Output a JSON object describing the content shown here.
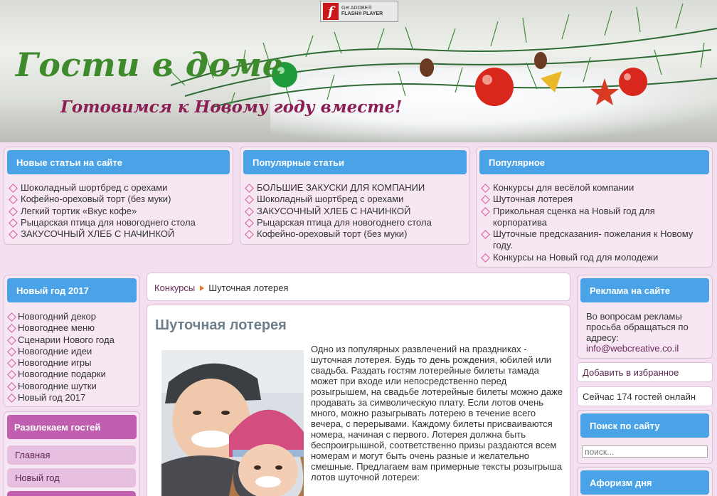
{
  "header": {
    "site_title": "Гости в доме",
    "slogan": "Готовимся к Новому году вместе!",
    "flash_badge": {
      "line1": "Get ADOBE®",
      "line2": "FLASH® PLAYER"
    }
  },
  "top_boxes": [
    {
      "title": "Новые статьи на сайте",
      "items": [
        "Шоколадный шортбред с орехами",
        "Кофейно-ореховый торт (без муки)",
        "Легкий тортик «Вкус кофе»",
        "Рыцарская птица для новогоднего стола",
        "ЗАКУСОЧНЫЙ ХЛЕБ С НАЧИНКОЙ"
      ]
    },
    {
      "title": "Популярные статьи",
      "items": [
        "БОЛЬШИЕ ЗАКУСКИ ДЛЯ КОМПАНИИ",
        "Шоколадный шортбред с орехами",
        "ЗАКУСОЧНЫЙ ХЛЕБ С НАЧИНКОЙ",
        "Рыцарская птица для новогоднего стола",
        "Кофейно-ореховый торт (без муки)"
      ]
    },
    {
      "title": "Популярное",
      "items": [
        "Конкурсы для весёлой компании",
        "Шуточная лотерея",
        "Прикольная сценка на Новый год для корпоратива",
        "Шуточные предсказания- пожелания к Новому году.",
        "Конкурсы на Новый год для молодежи"
      ]
    }
  ],
  "left_sidebar": {
    "newyear_box": {
      "title": "Новый год 2017",
      "items": [
        "Новогодний декор",
        "Новогоднее меню",
        "Сценарии Нового года",
        "Новогодние идеи",
        "Новогодние игры",
        "Новогодние подарки",
        "Новогодние шутки",
        "Новый год 2017"
      ]
    },
    "menu_box": {
      "title": "Развлекаем гостей",
      "items": [
        "Главная",
        "Новый год"
      ]
    }
  },
  "breadcrumb": {
    "items": [
      "Конкурсы",
      "Шуточная лотерея"
    ]
  },
  "article": {
    "title": "Шуточная лотерея",
    "body": "Одно из популярных развлечений на праздниках - шуточная лотерея. Будь то день рождения, юбилей или свадьба. Раздать гостям лотерейные билеты тамада может при входе или непосредственно перед розыгрышем, на свадьбе лотерейные билеты можно даже продавать за символическую плату. Если лотов очень много, можно разыгрывать лотерею в течение всего вечера, с перерывами. Каждому билеты присваиваются номера, начиная с первого. Лотерея должна быть беспроигрышной, соответственно призы раздаются всем номерам и могут быть очень разные и желательно смешные. Предлагаем вам примерные тексты розыгрыша лотов шуточной лотереи:"
  },
  "right_sidebar": {
    "ads": {
      "title": "Реклама на сайте",
      "text": "Во вопросам рекламы просьба обращаться по адресу:",
      "email": "info@webcreative.co.il"
    },
    "favorite_link": "Добавить в избранное",
    "online": "Сейчас 174 гостей онлайн",
    "search": {
      "title": "Поиск по сайту",
      "placeholder": "поиск..."
    },
    "aphorism": {
      "title": "Афоризм дня"
    }
  }
}
